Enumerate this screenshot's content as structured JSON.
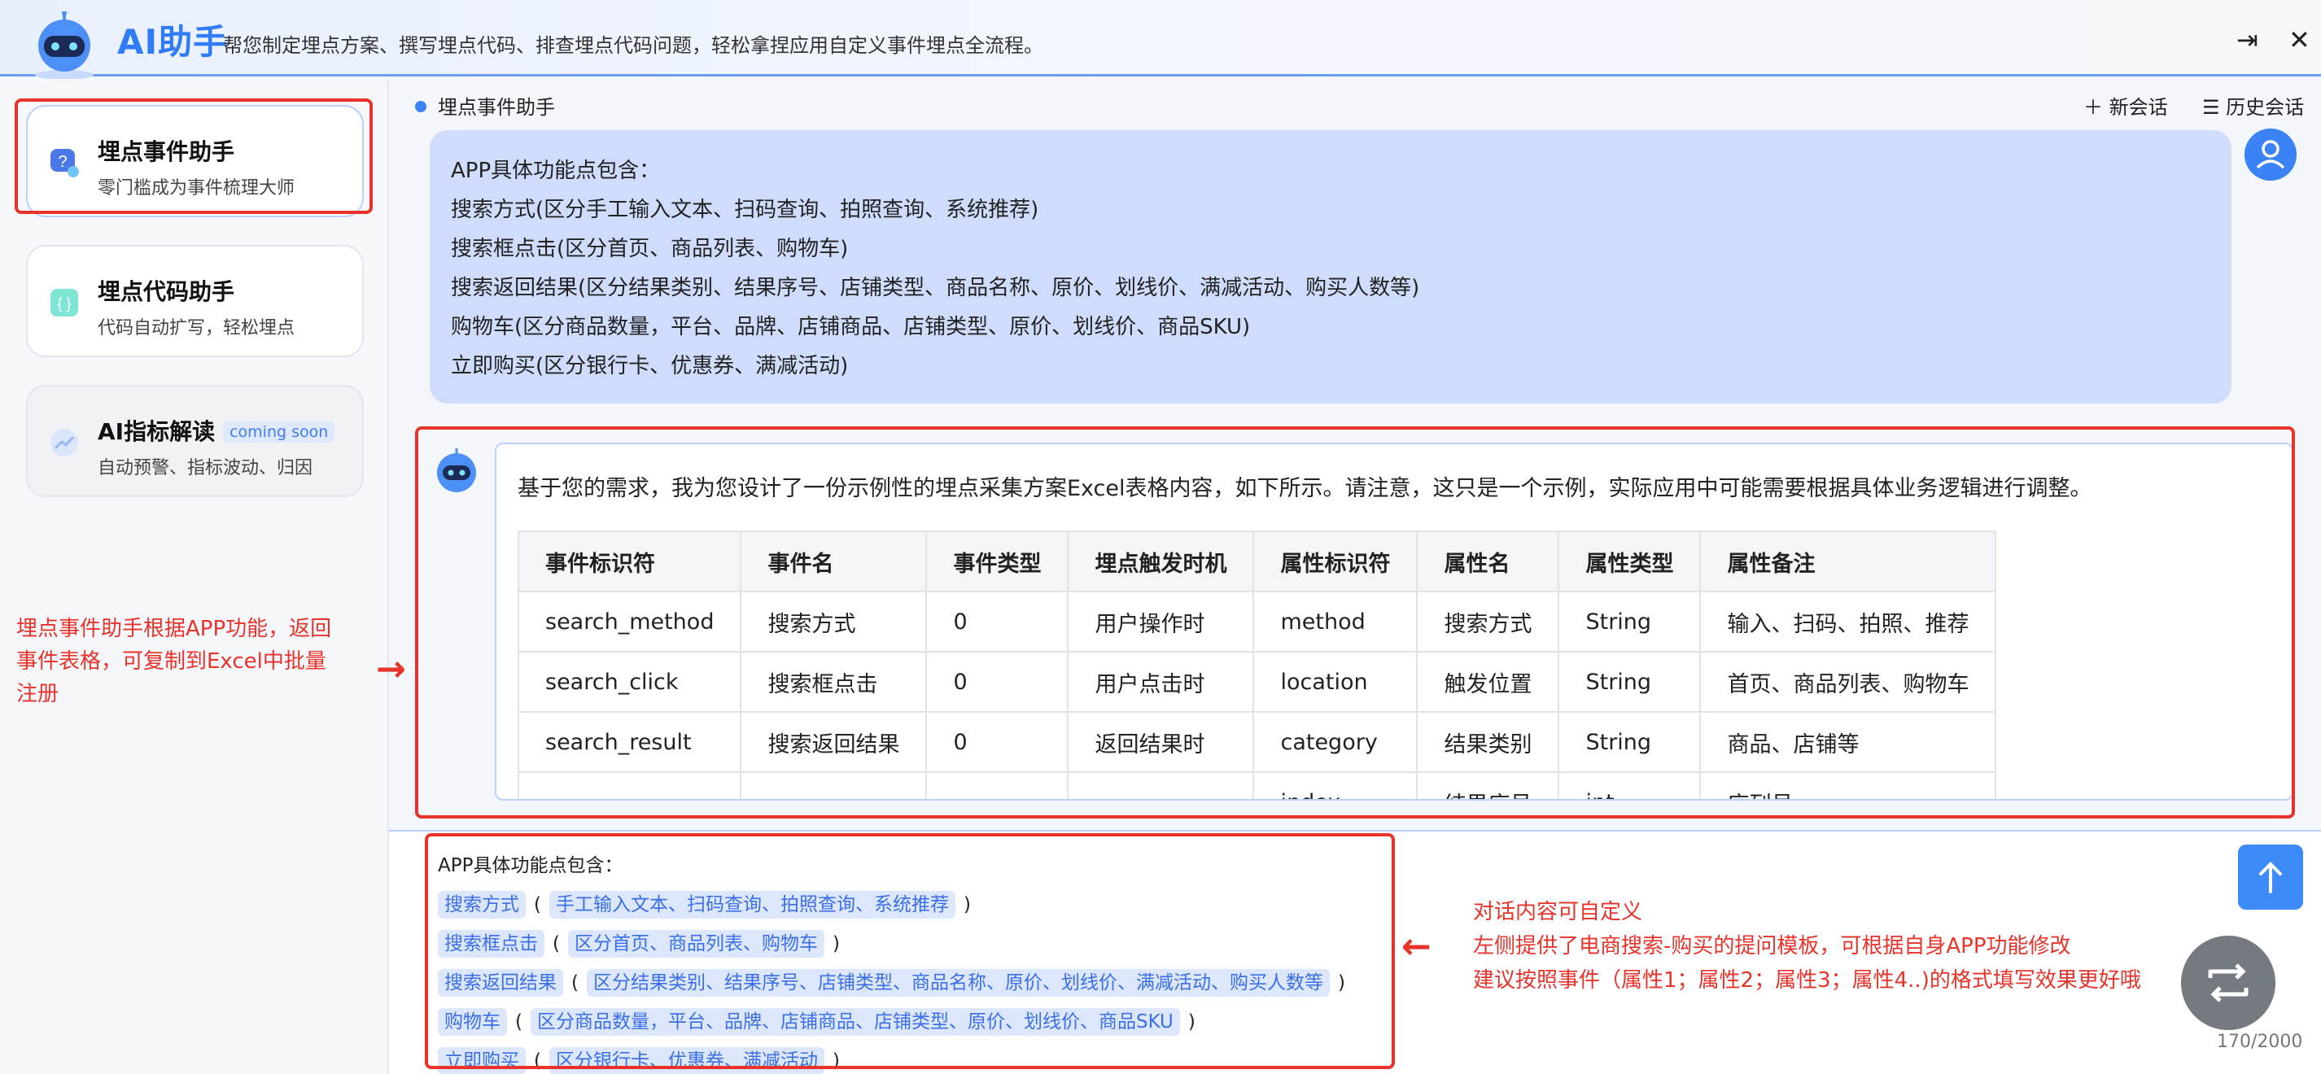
{
  "header": {
    "brand": "AI助手",
    "subtitle": "帮您制定埋点方案、撰写埋点代码、排查埋点代码问题，轻松拿捏应用自定义事件埋点全流程。",
    "collapse_icon": "⇥",
    "close_icon": "✕"
  },
  "sidebar": {
    "items": [
      {
        "title": "埋点事件助手",
        "subtitle": "零门槛成为事件梳理大师"
      },
      {
        "title": "埋点代码助手",
        "subtitle": "代码自动扩写，轻松埋点"
      },
      {
        "title": "AI指标解读",
        "badge": "coming soon",
        "subtitle": "自动预警、指标波动、归因"
      }
    ],
    "annotation": [
      "埋点事件助手根据APP功能，返回",
      "事件表格，可复制到Excel中批量",
      "注册"
    ]
  },
  "main": {
    "assistant_name": "埋点事件助手",
    "new_chat": "新会话",
    "history": "历史会话",
    "user_message": [
      "APP具体功能点包含：",
      "搜索方式(区分手工输入文本、扫码查询、拍照查询、系统推荐)",
      "搜索框点击(区分首页、商品列表、购物车)",
      "搜索返回结果(区分结果类别、结果序号、店铺类型、商品名称、原价、划线价、满减活动、购买人数等)",
      "购物车(区分商品数量，平台、品牌、店铺商品、店铺类型、原价、划线价、商品SKU)",
      "立即购买(区分银行卡、优惠券、满减活动)"
    ],
    "bot_intro": "基于您的需求，我为您设计了一份示例性的埋点采集方案Excel表格内容，如下所示。请注意，这只是一个示例，实际应用中可能需要根据具体业务逻辑进行调整。",
    "table": {
      "headers": [
        "事件标识符",
        "事件名",
        "事件类型",
        "埋点触发时机",
        "属性标识符",
        "属性名",
        "属性类型",
        "属性备注"
      ],
      "rows": [
        [
          "search_method",
          "搜索方式",
          "0",
          "用户操作时",
          "method",
          "搜索方式",
          "String",
          "输入、扫码、拍照、推荐"
        ],
        [
          "search_click",
          "搜索框点击",
          "0",
          "用户点击时",
          "location",
          "触发位置",
          "String",
          "首页、商品列表、购物车"
        ],
        [
          "search_result",
          "搜索返回结果",
          "0",
          "返回结果时",
          "category",
          "结果类别",
          "String",
          "商品、店铺等"
        ],
        [
          "",
          "",
          "",
          "",
          "index",
          "结果序号",
          "int",
          "序列号"
        ]
      ]
    }
  },
  "input": {
    "heading": "APP具体功能点包含：",
    "lines": [
      {
        "name": "搜索方式",
        "detail": "手工输入文本、扫码查询、拍照查询、系统推荐"
      },
      {
        "name": "搜索框点击",
        "detail": "区分首页、商品列表、购物车"
      },
      {
        "name": "搜索返回结果",
        "detail": "区分结果类别、结果序号、店铺类型、商品名称、原价、划线价、满减活动、购买人数等"
      },
      {
        "name": "购物车",
        "detail": "区分商品数量，平台、品牌、店铺商品、店铺类型、原价、划线价、商品SKU"
      },
      {
        "name": "立即购买",
        "detail": "区分银行卡、优惠券、满减活动"
      }
    ],
    "annotation": [
      "对话内容可自定义",
      "左侧提供了电商搜索-购买的提问模板，可根据自身APP功能修改",
      "建议按照事件（属性1；属性2；属性3；属性4..)的格式填写效果更好哦"
    ],
    "counter": "170/2000",
    "open_paren": "(",
    "close_paren": ")"
  },
  "colors": {
    "accent": "#2f7cf6",
    "annotation_red": "#e8332b",
    "user_bubble": "#cfdcfb"
  }
}
